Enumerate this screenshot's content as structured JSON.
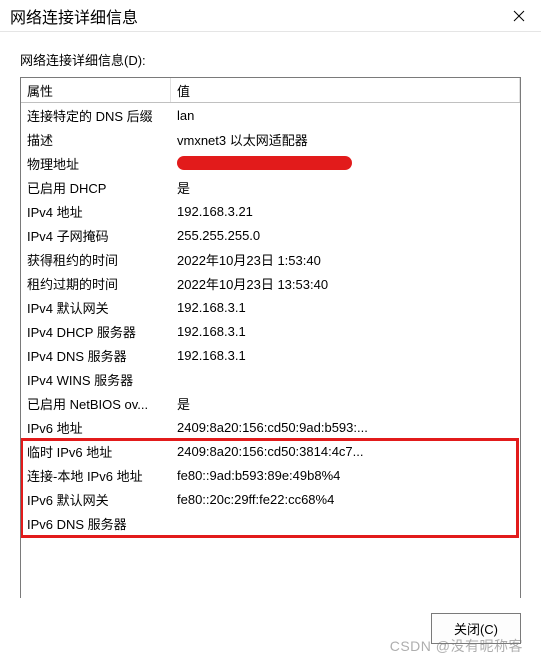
{
  "titlebar": {
    "title": "网络连接详细信息"
  },
  "section_label": "网络连接详细信息(D):",
  "headers": {
    "property": "属性",
    "value": "值"
  },
  "rows": [
    {
      "prop": "连接特定的 DNS 后缀",
      "val": "lan"
    },
    {
      "prop": "描述",
      "val": "vmxnet3 以太网适配器"
    },
    {
      "prop": "物理地址",
      "val": "__REDACTED__"
    },
    {
      "prop": "已启用 DHCP",
      "val": "是"
    },
    {
      "prop": "IPv4 地址",
      "val": "192.168.3.21"
    },
    {
      "prop": "IPv4 子网掩码",
      "val": "255.255.255.0"
    },
    {
      "prop": "获得租约的时间",
      "val": "2022年10月23日 1:53:40"
    },
    {
      "prop": "租约过期的时间",
      "val": "2022年10月23日 13:53:40"
    },
    {
      "prop": "IPv4 默认网关",
      "val": "192.168.3.1"
    },
    {
      "prop": "IPv4 DHCP 服务器",
      "val": "192.168.3.1"
    },
    {
      "prop": "IPv4 DNS 服务器",
      "val": "192.168.3.1"
    },
    {
      "prop": "IPv4 WINS 服务器",
      "val": ""
    },
    {
      "prop": "已启用 NetBIOS ov...",
      "val": "是"
    },
    {
      "prop": "IPv6 地址",
      "val": "2409:8a20:156:cd50:9ad:b593:..."
    },
    {
      "prop": "临时 IPv6 地址",
      "val": "2409:8a20:156:cd50:3814:4c7..."
    },
    {
      "prop": "连接-本地 IPv6 地址",
      "val": "fe80::9ad:b593:89e:49b8%4"
    },
    {
      "prop": "IPv6 默认网关",
      "val": "fe80::20c:29ff:fe22:cc68%4"
    },
    {
      "prop": "IPv6 DNS 服务器",
      "val": ""
    }
  ],
  "close_button": "关闭(C)",
  "watermark": "CSDN @没有昵称客"
}
